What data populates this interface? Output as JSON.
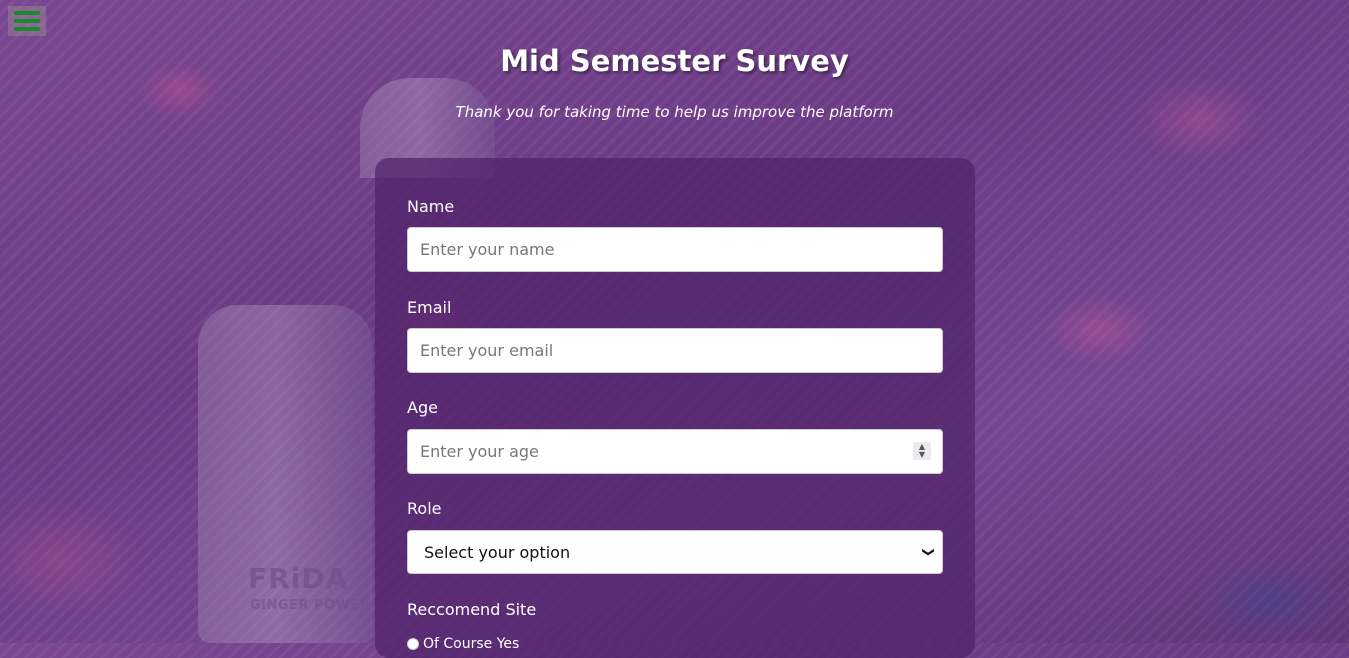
{
  "menu": {
    "icon": "hamburger-menu-icon"
  },
  "header": {
    "title": "Mid Semester Survey",
    "subtitle": "Thank you for taking time to help us improve the platform"
  },
  "background": {
    "brand_text": "FRiDA",
    "brand_sub": "GINGER POWER"
  },
  "form": {
    "name": {
      "label": "Name",
      "placeholder": "Enter your name"
    },
    "email": {
      "label": "Email",
      "placeholder": "Enter your email"
    },
    "age": {
      "label": "Age",
      "placeholder": "Enter your age"
    },
    "role": {
      "label": "Role",
      "selected": "Select your option"
    },
    "recommend": {
      "label": "Reccomend Site",
      "first_option": "Of Course Yes"
    }
  },
  "colors": {
    "menu_lines": "#1a8a2a",
    "card": "#50236 9"
  }
}
